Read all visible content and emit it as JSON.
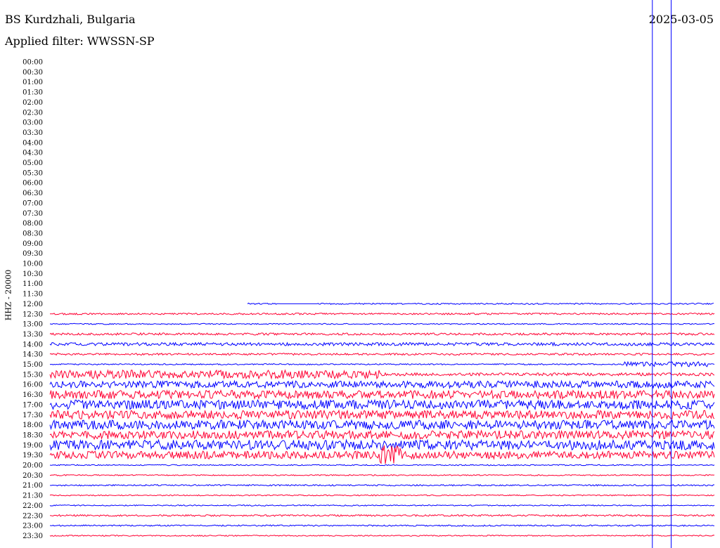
{
  "header": {
    "station": "BS Kurdzhali, Bulgaria",
    "date": "2025-03-05",
    "filter_label": "Applied filter: WWSSN-SP",
    "channel": "HHZ - 20000"
  },
  "chart_data": {
    "type": "line",
    "title": "BS Kurdzhali, Bulgaria",
    "subtitle": "Applied filter: WWSSN-SP",
    "ylabel": "HHZ - 20000",
    "row_labels": [
      "00:00",
      "00:30",
      "01:00",
      "01:30",
      "02:00",
      "02:30",
      "03:00",
      "03:30",
      "04:00",
      "04:30",
      "05:00",
      "05:30",
      "06:00",
      "06:30",
      "07:00",
      "07:30",
      "08:00",
      "08:30",
      "09:00",
      "09:30",
      "10:00",
      "10:30",
      "11:00",
      "11:30",
      "12:00",
      "12:30",
      "13:00",
      "13:30",
      "14:00",
      "14:30",
      "15:00",
      "15:30",
      "16:00",
      "16:30",
      "17:00",
      "17:30",
      "18:00",
      "18:30",
      "19:00",
      "19:30",
      "20:00",
      "20:30",
      "21:00",
      "21:30",
      "22:00",
      "22:30",
      "23:00",
      "23:30"
    ],
    "first_trace_row": "12:00",
    "trace_colors": [
      "#0000ff",
      "#ff0033"
    ],
    "amplitudes": {
      "12:00": 1,
      "12:30": 1.2,
      "13:00": 0.8,
      "13:30": 1.6,
      "14:00": 2.2,
      "14:30": 1.4,
      "15:00": 0.9,
      "15:30": 6,
      "16:00": 5,
      "16:30": 6,
      "17:00": 6.5,
      "17:30": 6,
      "18:00": 6.5,
      "18:30": 6,
      "19:00": 7,
      "19:30": 5.5,
      "20:00": 0.8,
      "20:30": 0.8,
      "21:00": 1,
      "21:30": 0.8,
      "22:00": 0.8,
      "22:30": 1.2,
      "23:00": 1,
      "23:30": 0.8
    },
    "marker_lines": [
      {
        "time": "12:32",
        "color": "#0000ff"
      },
      {
        "time": "12:33",
        "color": "#0000ff"
      },
      {
        "time": "29:42",
        "color": "#0000ff"
      }
    ]
  }
}
